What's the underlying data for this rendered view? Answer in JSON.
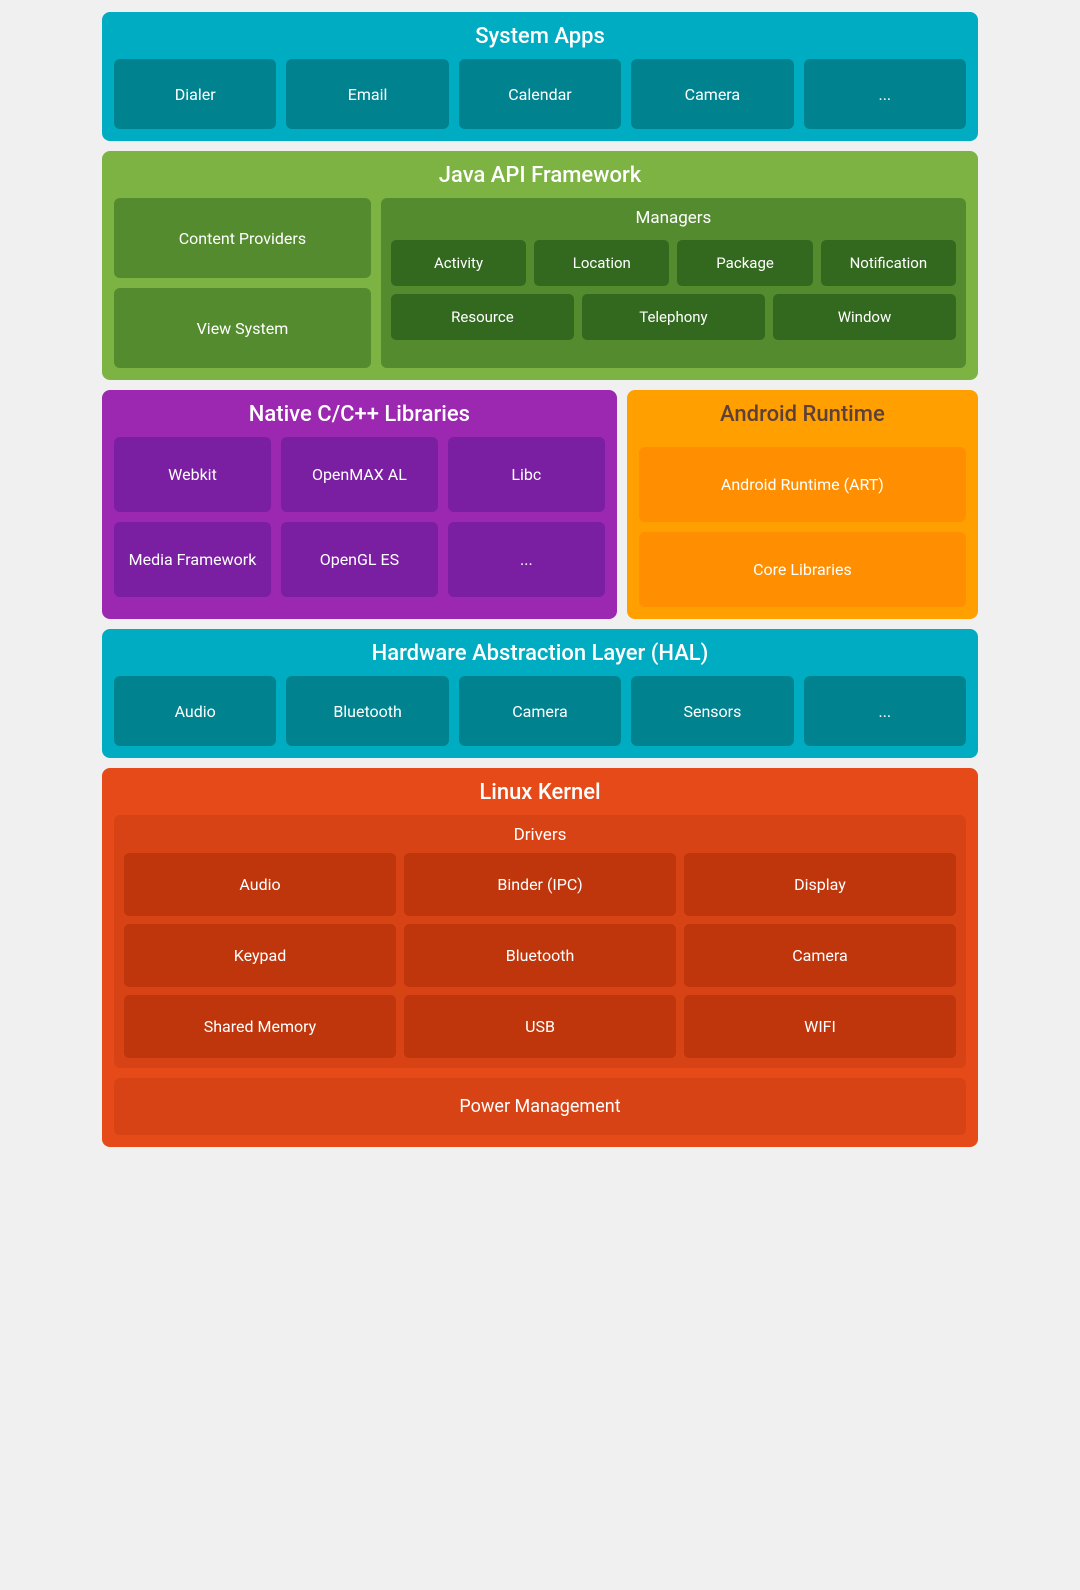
{
  "systemApps": {
    "title": "System Apps",
    "items": [
      "Dialer",
      "Email",
      "Calendar",
      "Camera",
      "..."
    ]
  },
  "javaApi": {
    "title": "Java API Framework",
    "leftItems": [
      "Content Providers",
      "View System"
    ],
    "managers": {
      "title": "Managers",
      "row1": [
        "Activity",
        "Location",
        "Package",
        "Notification"
      ],
      "row2": [
        "Resource",
        "Telephony",
        "Window"
      ]
    }
  },
  "nativeLibs": {
    "title": "Native C/C++ Libraries",
    "row1": [
      "Webkit",
      "OpenMAX AL",
      "Libc"
    ],
    "row2": [
      "Media Framework",
      "OpenGL ES",
      "..."
    ]
  },
  "androidRuntime": {
    "title": "Android Runtime",
    "items": [
      "Android Runtime (ART)",
      "Core Libraries"
    ]
  },
  "hal": {
    "title": "Hardware Abstraction Layer (HAL)",
    "items": [
      "Audio",
      "Bluetooth",
      "Camera",
      "Sensors",
      "..."
    ]
  },
  "linuxKernel": {
    "title": "Linux Kernel",
    "drivers": {
      "title": "Drivers",
      "row1": [
        "Audio",
        "Binder (IPC)",
        "Display"
      ],
      "row2": [
        "Keypad",
        "Bluetooth",
        "Camera"
      ],
      "row3": [
        "Shared Memory",
        "USB",
        "WIFI"
      ]
    },
    "powerManagement": "Power Management"
  }
}
